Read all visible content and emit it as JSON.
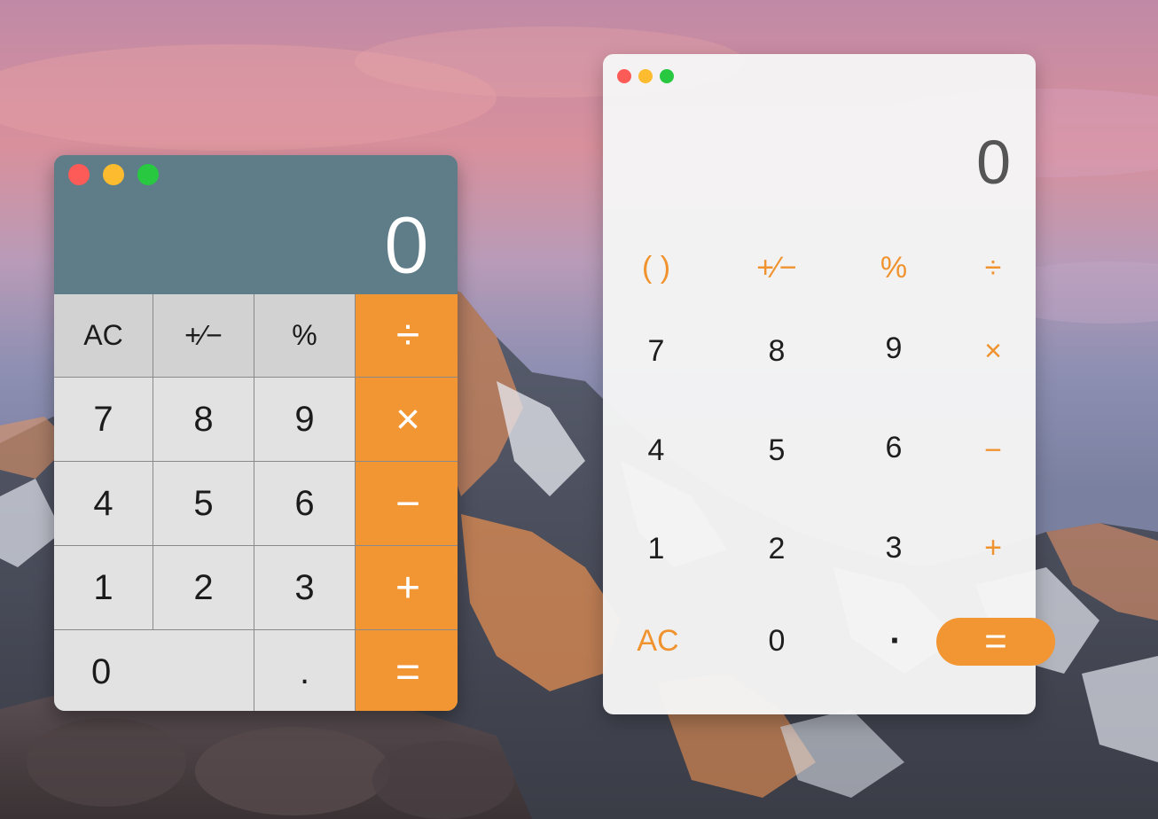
{
  "wallpaper": {
    "description_colors": {
      "sky_top": "#c98c9e",
      "sky_mid": "#8f86a6",
      "mountain_dark": "#3c4250",
      "alpenglow": "#e78a4e",
      "snow": "#e8eaf0"
    }
  },
  "classic_calculator": {
    "display_value": "0",
    "colors": {
      "display_bg": "#5e7d88",
      "key_bg": "#e2e2e2",
      "fn_key_bg": "#d2d2d2",
      "operator_bg": "#f29633"
    },
    "keys": {
      "ac": "AC",
      "plus_minus": "+∕−",
      "percent": "%",
      "divide": "÷",
      "seven": "7",
      "eight": "8",
      "nine": "9",
      "multiply": "×",
      "four": "4",
      "five": "5",
      "six": "6",
      "minus": "−",
      "one": "1",
      "two": "2",
      "three": "3",
      "plus": "+",
      "zero": "0",
      "decimal": ".",
      "equals": "="
    }
  },
  "modern_calculator": {
    "display_value": "0",
    "colors": {
      "window_bg": "#f5f5f5",
      "accent": "#f0932f",
      "digit": "#1e1e1e"
    },
    "keys": {
      "parentheses": "( )",
      "plus_minus": "+∕−",
      "percent": "%",
      "divide": "÷",
      "seven": "7",
      "eight": "8",
      "nine": "9",
      "multiply": "×",
      "four": "4",
      "five": "5",
      "six": "6",
      "minus": "−",
      "one": "1",
      "two": "2",
      "three": "3",
      "plus": "+",
      "ac": "AC",
      "zero": "0",
      "decimal": "·",
      "equals": "="
    }
  }
}
